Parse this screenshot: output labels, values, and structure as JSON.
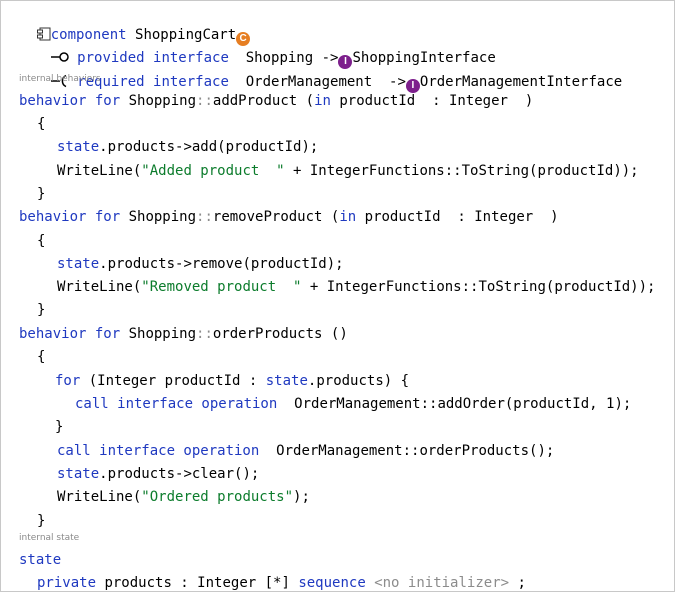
{
  "header": {
    "keyword": "component",
    "name": "ShoppingCart",
    "badge_letter": "C",
    "badge_color": "#e67e22",
    "icon": "component-icon"
  },
  "provided": {
    "kw": "provided interface",
    "name": "Shopping",
    "arrow": "->",
    "badge_letter": "I",
    "badge_color": "#7d1f8c",
    "target": "ShoppingInterface"
  },
  "required": {
    "kw": "required interface",
    "name": "OrderManagement",
    "arrow": "->",
    "badge_letter": "I",
    "target": "OrderManagementInterface"
  },
  "section_internal_behaviors": "internal behaviors",
  "behavior_add": {
    "kw": "behavior for",
    "name": "Shopping",
    "sep": "::",
    "op": "addProduct",
    "lparen": "(",
    "param_kw": "in",
    "param": "productId",
    "colon": ":",
    "type": "Integer",
    "rparen": ")",
    "open": "{",
    "l1_state": "state",
    "l1_rest": ".products->add(productId);",
    "l2_fn": "WriteLine(",
    "l2_str": "\"Added product  \"",
    "l2_rest": " + IntegerFunctions::ToString(productId));",
    "close": "}"
  },
  "behavior_remove": {
    "kw": "behavior for",
    "name": "Shopping",
    "sep": "::",
    "op": "removeProduct",
    "lparen": "(",
    "param_kw": "in",
    "param": "productId",
    "colon": ":",
    "type": "Integer",
    "rparen": ")",
    "open": "{",
    "l1_state": "state",
    "l1_rest": ".products->remove(productId);",
    "l2_fn": "WriteLine(",
    "l2_str": "\"Removed product  \"",
    "l2_rest": " + IntegerFunctions::ToString(productId));",
    "close": "}"
  },
  "behavior_order": {
    "kw": "behavior for",
    "name": "Shopping",
    "sep": "::",
    "op": "orderProducts",
    "parens": "()",
    "open": "{",
    "for_kw": "for",
    "for_head": "(Integer productId : ",
    "for_state": "state",
    "for_tail": ".products) {",
    "call_kw1": "call interface operation",
    "call1": "OrderManagement::addOrder(productId, 1);",
    "inner_close": "}",
    "call_kw2": "call interface operation",
    "call2": "OrderManagement::orderProducts();",
    "clear_state": "state",
    "clear_rest": ".products->clear();",
    "w_fn": "WriteLine(",
    "w_str": "\"Ordered products\"",
    "w_end": ");",
    "close": "}"
  },
  "section_internal_state": "internal state",
  "state": {
    "kw": "state",
    "private_kw": "private",
    "attr": "products : Integer [*]",
    "seq_kw": "sequence",
    "init": "<no initializer>",
    "end": ";"
  }
}
